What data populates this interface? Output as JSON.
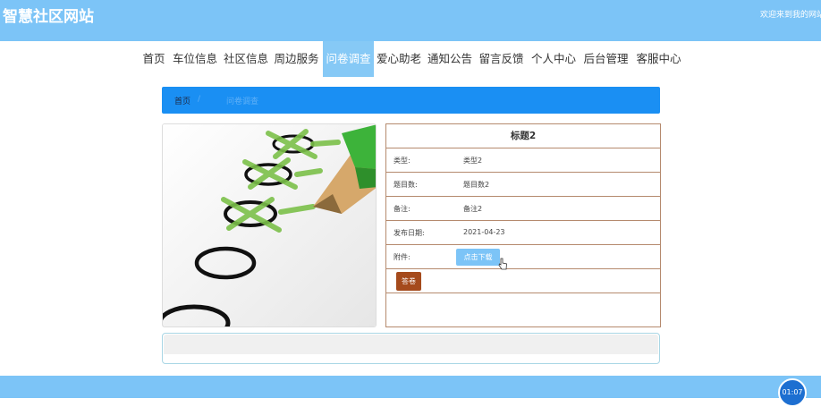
{
  "header": {
    "site_title": "智慧社区网站",
    "welcome_text": "欢迎来到我的网站"
  },
  "nav": {
    "items": [
      {
        "label": "首页"
      },
      {
        "label": "车位信息"
      },
      {
        "label": "社区信息"
      },
      {
        "label": "周边服务"
      },
      {
        "label": "问卷调查",
        "active": true
      },
      {
        "label": "爱心助老"
      },
      {
        "label": "通知公告"
      },
      {
        "label": "留言反馈"
      },
      {
        "label": "个人中心"
      },
      {
        "label": "后台管理"
      },
      {
        "label": "客服中心"
      }
    ]
  },
  "breadcrumb": {
    "home": "首页",
    "separator": "/",
    "current": "问卷调查"
  },
  "detail": {
    "title": "标题2",
    "rows": [
      {
        "label": "类型:",
        "value": "类型2"
      },
      {
        "label": "题目数:",
        "value": "题目数2"
      },
      {
        "label": "备注:",
        "value": "备注2"
      },
      {
        "label": "发布日期:",
        "value": "2021-04-23"
      },
      {
        "label": "附件:"
      }
    ],
    "download_label": "点击下载",
    "answer_label": "答卷"
  },
  "timer": {
    "label": "01:07"
  },
  "colors": {
    "header_bg": "#7cc4f7",
    "breadcrumb_bg": "#1a8ff3",
    "answer_button": "#a54a1c",
    "table_border": "#b58a6e"
  }
}
